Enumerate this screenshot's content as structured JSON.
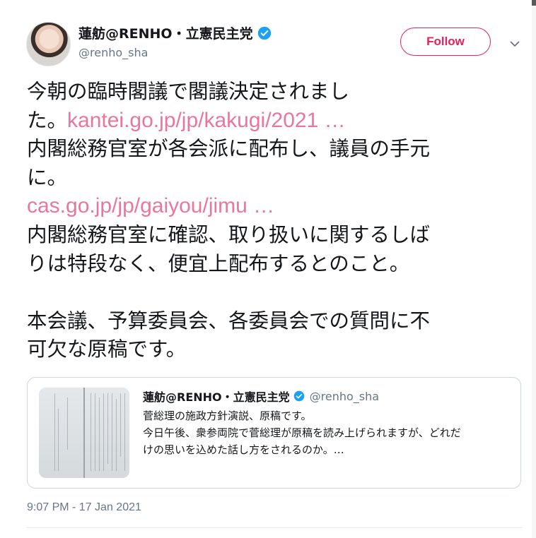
{
  "author": {
    "name": "蓮舫@RENHO・立憲民主党",
    "handle": "@renho_sha"
  },
  "follow_label": "Follow",
  "body": {
    "line1": "今朝の臨時閣議で閣議決定されまし",
    "line2_prefix": "た。",
    "link1": "kantei.go.jp/jp/kakugi/2021 …",
    "line3": "内閣総務官室が各会派に配布し、議員の手元",
    "line4": "に。",
    "link2": "cas.go.jp/jp/gaiyou/jimu …",
    "line5": "内閣総務官室に確認、取り扱いに関するしば",
    "line6": "りは特段なく、便宜上配布するとのこと。",
    "line7": "本会議、予算委員会、各委員会での質問に不",
    "line8": "可欠な原稿です。"
  },
  "quote": {
    "name": "蓮舫@RENHO・立憲民主党",
    "handle": "@renho_sha",
    "line1": "菅総理の施政方針演説、原稿です。",
    "line2": "今日午後、衆参両院で菅総理が原稿を読み上げられますが、どれだ",
    "line3": "けの思いを込めた話し方をされるのか。…"
  },
  "timestamp": "9:07 PM - 17 Jan 2021",
  "icons": {
    "verified": "verified-badge-icon",
    "caret": "chevron-down-icon"
  },
  "colors": {
    "accent": "#e0245e",
    "verified": "#1da1f2",
    "secondary_text": "#657786",
    "border": "#ccd6dd"
  }
}
